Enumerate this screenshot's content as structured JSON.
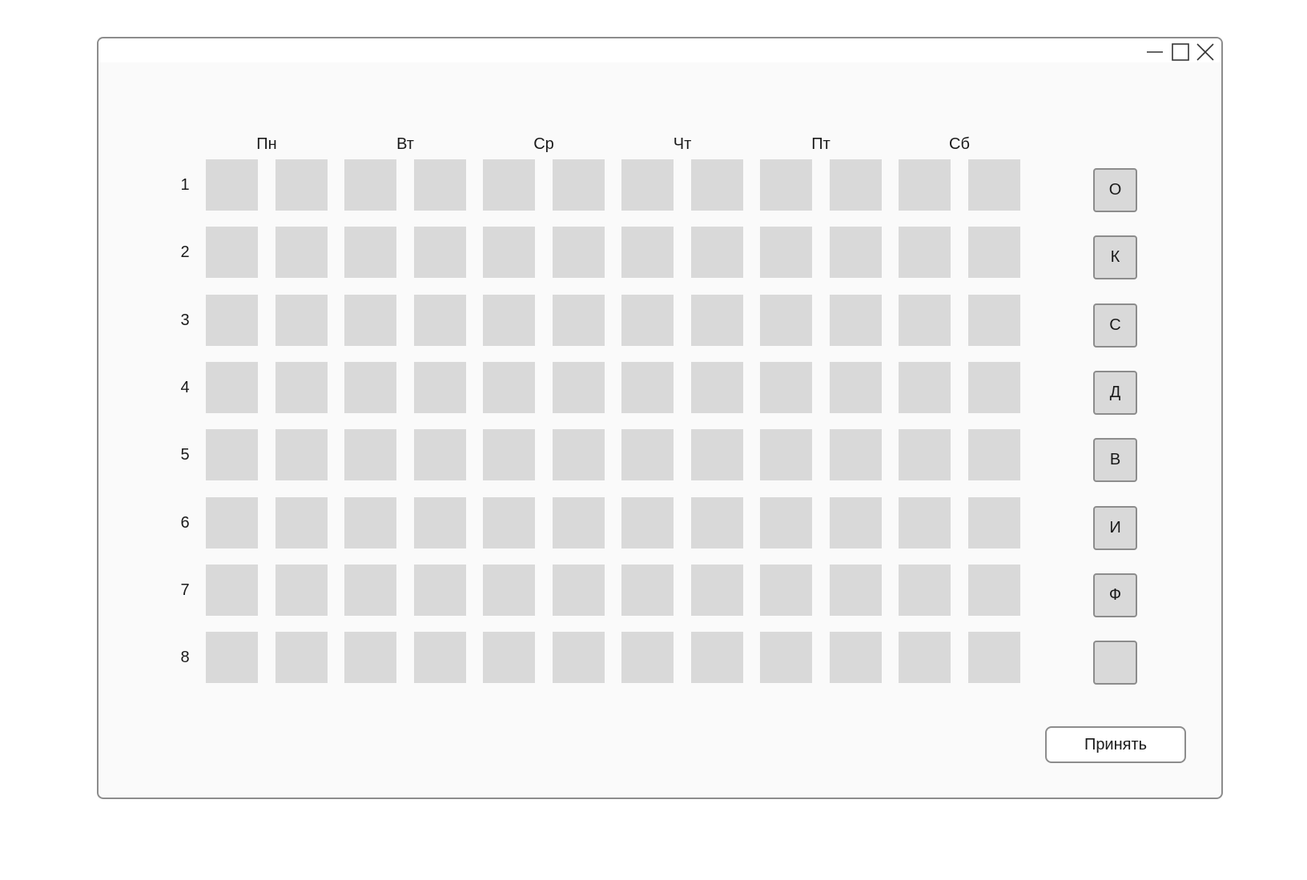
{
  "window": {
    "controls": {
      "minimize_icon": "minimize-icon",
      "maximize_icon": "maximize-icon",
      "close_icon": "close-icon"
    }
  },
  "schedule": {
    "days": [
      "Пн",
      "Вт",
      "Ср",
      "Чт",
      "Пт",
      "Сб"
    ],
    "rows": [
      "1",
      "2",
      "3",
      "4",
      "5",
      "6",
      "7",
      "8"
    ],
    "cells_per_day": 2,
    "cell_color": "#d9d9d9"
  },
  "side_buttons": [
    "О",
    "К",
    "С",
    "Д",
    "В",
    "И",
    "Ф",
    ""
  ],
  "footer": {
    "accept_label": "Принять"
  },
  "colors": {
    "border": "#8c8c8c",
    "window_bg": "#fafafa",
    "text": "#1a1a1a"
  }
}
